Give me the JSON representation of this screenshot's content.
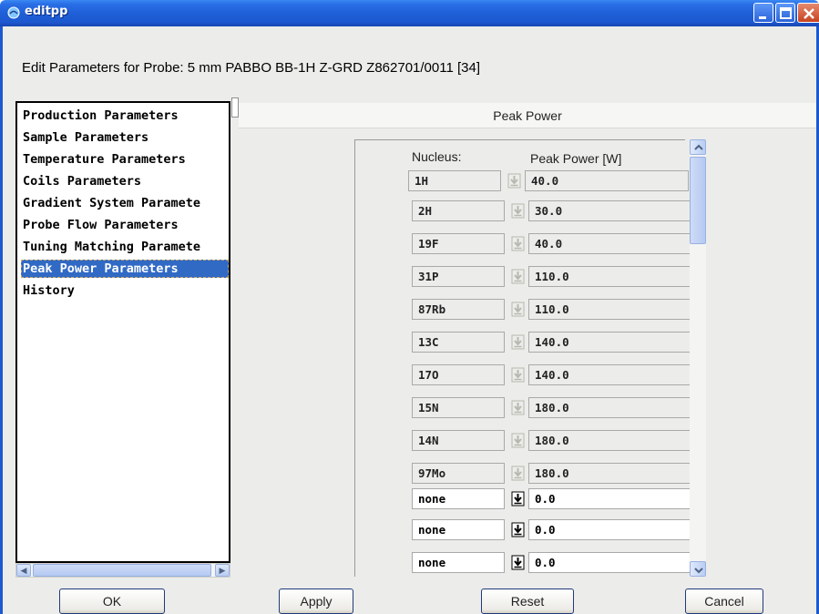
{
  "window": {
    "title": "editpp"
  },
  "header": {
    "text": "Edit Parameters for Probe:  5 mm PABBO BB-1H Z-GRD Z862701/0011 [34]"
  },
  "sidebar": {
    "items": [
      {
        "label": "Production Parameters"
      },
      {
        "label": "Sample Parameters"
      },
      {
        "label": "Temperature Parameters"
      },
      {
        "label": "Coils Parameters"
      },
      {
        "label": "Gradient System Paramete"
      },
      {
        "label": "Probe Flow Parameters"
      },
      {
        "label": "Tuning Matching Paramete"
      },
      {
        "label": "Peak Power Parameters",
        "selected": true
      },
      {
        "label": "History"
      }
    ]
  },
  "panel": {
    "title": "Peak Power",
    "col_nucleus": "Nucleus:",
    "col_power": "Peak Power [W]",
    "rows": [
      {
        "nucleus": "1H",
        "power": "40.0",
        "editable": false
      },
      {
        "nucleus": "2H",
        "power": "30.0",
        "editable": false
      },
      {
        "nucleus": "19F",
        "power": "40.0",
        "editable": false
      },
      {
        "nucleus": "31P",
        "power": "110.0",
        "editable": false
      },
      {
        "nucleus": "87Rb",
        "power": "110.0",
        "editable": false
      },
      {
        "nucleus": "13C",
        "power": "140.0",
        "editable": false
      },
      {
        "nucleus": "17O",
        "power": "140.0",
        "editable": false
      },
      {
        "nucleus": "15N",
        "power": "180.0",
        "editable": false
      },
      {
        "nucleus": "14N",
        "power": "180.0",
        "editable": false
      },
      {
        "nucleus": "97Mo",
        "power": "180.0",
        "editable": false
      },
      {
        "nucleus": "none",
        "power": "0.0",
        "editable": true
      },
      {
        "nucleus": "none",
        "power": "0.0",
        "editable": true
      },
      {
        "nucleus": "none",
        "power": "0.0",
        "editable": true
      }
    ]
  },
  "buttons": {
    "ok": "OK",
    "apply": "Apply",
    "reset": "Reset",
    "cancel": "Cancel"
  },
  "colors": {
    "titlebar": "#1f5fd8",
    "selection": "#316ac5",
    "client_bg": "#ececea"
  },
  "icons": [
    "app-icon",
    "minimize-icon",
    "maximize-icon",
    "close-icon",
    "download-arrow-icon"
  ]
}
